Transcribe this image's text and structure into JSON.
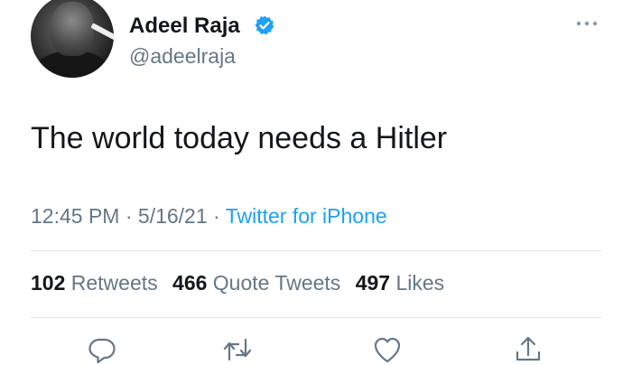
{
  "author": {
    "name": "Adeel Raja",
    "handle": "@adeelraja",
    "verified": true
  },
  "tweet": {
    "text": "The world today needs a Hitler",
    "time": "12:45 PM",
    "date": "5/16/21",
    "separator": "·",
    "source": "Twitter for iPhone"
  },
  "stats": {
    "retweets_count": "102",
    "retweets_label": "Retweets",
    "quotes_count": "466",
    "quotes_label": "Quote Tweets",
    "likes_count": "497",
    "likes_label": "Likes"
  },
  "icons": {
    "verified": "verified-badge-icon",
    "more": "more-options-icon",
    "reply": "reply-icon",
    "retweet": "retweet-icon",
    "like": "heart-icon",
    "share": "share-icon"
  },
  "colors": {
    "accent": "#1da1f2",
    "text": "#14171a",
    "secondary": "#657786",
    "divider": "#e1e8ed"
  }
}
